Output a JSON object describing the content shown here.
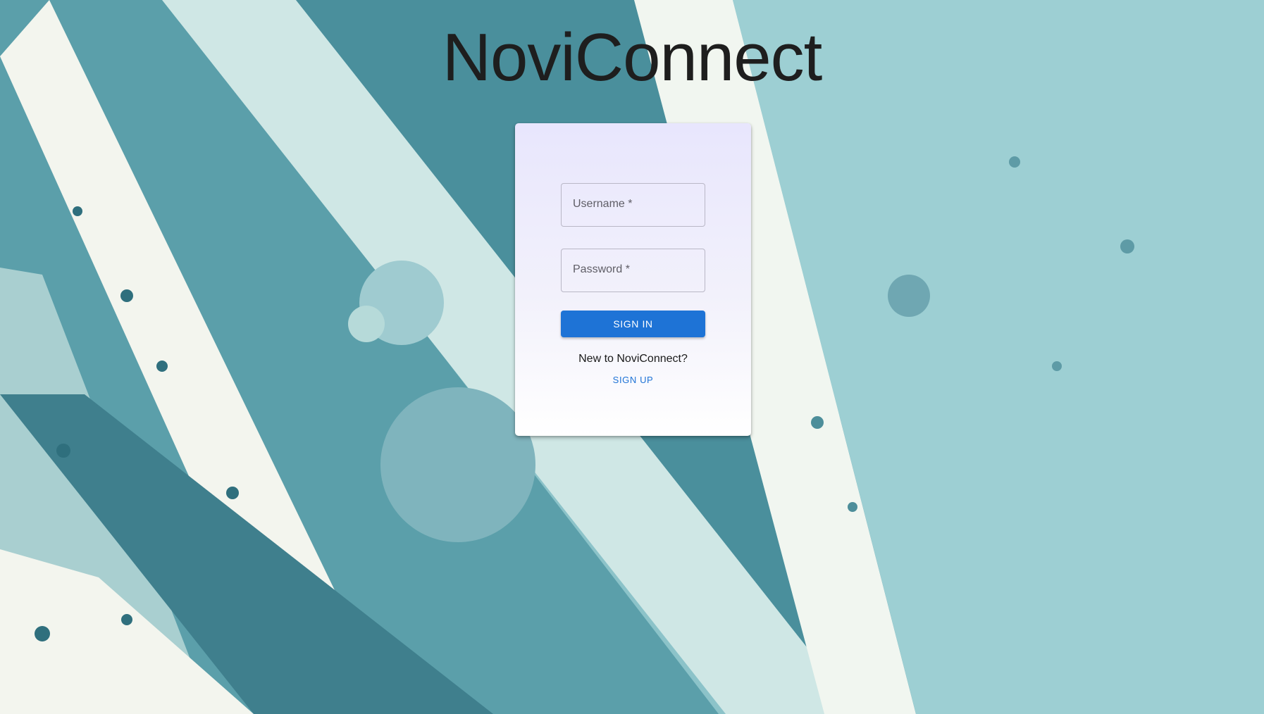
{
  "app": {
    "title": "NoviConnect"
  },
  "login_form": {
    "username_label": "Username *",
    "username_value": "",
    "password_label": "Password *",
    "password_value": "",
    "signin_label": "SIGN IN",
    "signup_prompt": "New to NoviConnect?",
    "signup_label": "SIGN UP"
  },
  "colors": {
    "primary_button": "#1e73d6",
    "link": "#1e73d6",
    "card_top": "#e8e6fd",
    "title_text": "#1e1e1e"
  }
}
